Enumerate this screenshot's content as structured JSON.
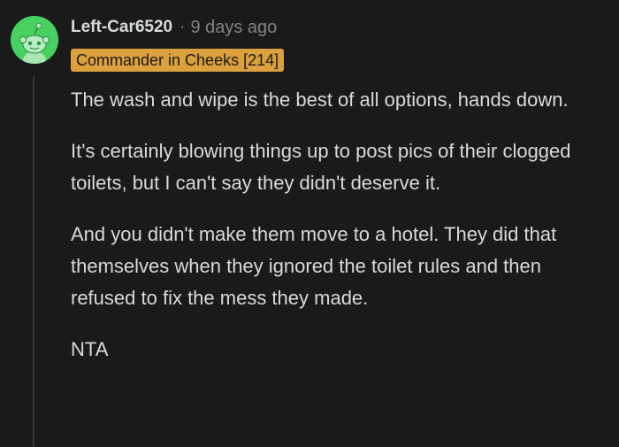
{
  "comment": {
    "username": "Left-Car6520",
    "separator": "·",
    "timestamp": "9 days ago",
    "flair": "Commander in Cheeks [214]",
    "paragraphs": [
      "The wash and wipe is the best of all options, hands down.",
      "It's certainly blowing things up to post pics of their clogged toilets, but I can't say they didn't deserve it.",
      "And you didn't make them move to a hotel. They did that themselves when they ignored the toilet rules and then refused to fix the mess they made.",
      "NTA"
    ]
  },
  "colors": {
    "background": "#1a1a1b",
    "text": "#d7dadc",
    "muted": "#818384",
    "avatar": "#46d160",
    "flair_bg": "#dca03c",
    "thread_line": "#343536"
  },
  "icons": {
    "avatar": "snoo-avatar-icon"
  }
}
